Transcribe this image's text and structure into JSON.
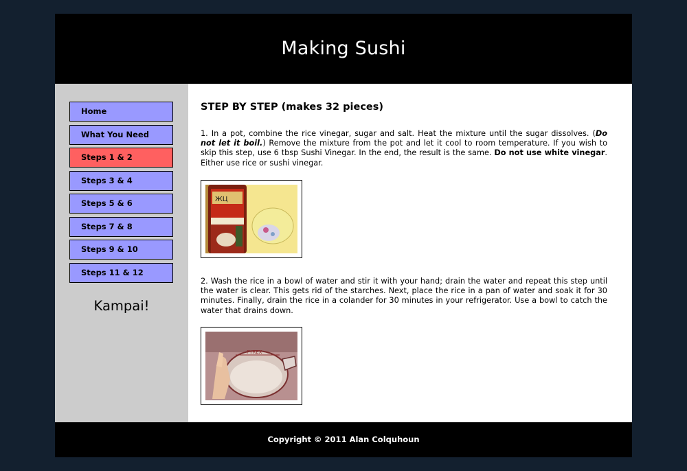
{
  "header": {
    "title": "Making Sushi"
  },
  "sidebar": {
    "nav": [
      {
        "label": "Home"
      },
      {
        "label": "What You Need"
      },
      {
        "label": "Steps 1 & 2"
      },
      {
        "label": "Steps 3 & 4"
      },
      {
        "label": "Steps 5 & 6"
      },
      {
        "label": "Steps 7 & 8"
      },
      {
        "label": "Steps 9 & 10"
      },
      {
        "label": "Steps 11 & 12"
      }
    ],
    "active_index": 2,
    "tagline": "Kampai!"
  },
  "content": {
    "heading": "STEP BY STEP (makes 32 pieces)",
    "step1": {
      "part1": "1. In a pot, combine the rice vinegar, sugar and salt. Heat the mixture until the sugar dissolves. (",
      "emphasis": "Do not let it boil.",
      "part2": ") Remove the mixture from the pot and let it cool to room temperature. If you wish to skip this step, use 6 tbsp Sushi Vinegar. In the end, the result is the same. ",
      "strong": "Do not use white vinegar",
      "part3": ". Either use rice or sushi vinegar."
    },
    "step2": {
      "text": "2. Wash the rice in a bowl of water and stir it with your hand; drain the water and repeat this step until the water is clear. This gets rid of the starches. Next, place the rice in a pan of water and soak it for 30 minutes. Finally, drain the rice in a colander for 30 minutes in your refrigerator. Use a bowl to catch the water that drains down."
    }
  },
  "footer": {
    "copyright": "Copyright © 2011 Alan Colquhoun"
  },
  "colors": {
    "background": "#13202f",
    "nav_default": "#9999ff",
    "nav_active": "#ff6060",
    "sidebar": "#cccccc"
  }
}
